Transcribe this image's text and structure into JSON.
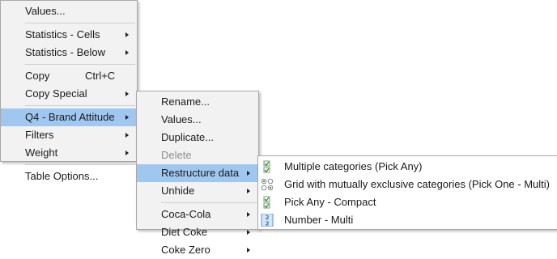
{
  "menu_main": {
    "values": "Values...",
    "statistics_cells": "Statistics - Cells",
    "statistics_below": "Statistics - Below",
    "copy": "Copy",
    "copy_shortcut": "Ctrl+C",
    "copy_special": "Copy Special",
    "q4_brand_attitude": "Q4 - Brand Attitude",
    "filters": "Filters",
    "weight": "Weight",
    "table_options": "Table Options..."
  },
  "menu_question": {
    "rename": "Rename...",
    "values": "Values...",
    "duplicate": "Duplicate...",
    "delete": "Delete",
    "restructure_data": "Restructure data",
    "unhide": "Unhide",
    "coca_cola": "Coca-Cola",
    "diet_coke": "Diet Coke",
    "coke_zero": "Coke Zero"
  },
  "menu_restructure": {
    "multiple_categories": "Multiple categories (Pick Any)",
    "grid_exclusive": "Grid with mutually exclusive categories (Pick One - Multi)",
    "pick_any_compact": "Pick Any - Compact",
    "number_multi": "Number - Multi"
  },
  "colors": {
    "highlight": "#9fc7ef",
    "menu_background": "#f2f2f2",
    "check_icon_green": "#3a9a3a",
    "number_icon_blue": "#2e6fc0"
  }
}
